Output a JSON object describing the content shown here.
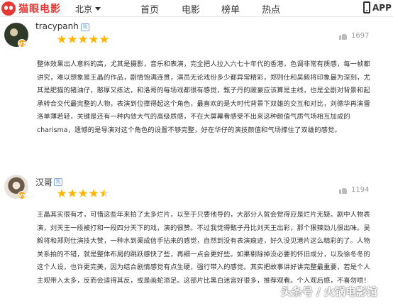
{
  "header": {
    "logo_text": "猫眼电影",
    "city": "北京",
    "nav": [
      "首页",
      "电影",
      "榜单",
      "热点"
    ],
    "app_label": "APP"
  },
  "reviews": [
    {
      "username": "tracypanh",
      "vip_label": "V2",
      "level_badge": "购",
      "rating": 5,
      "likes": "1697",
      "text": "整体效果出人意料的高，尤其是摄影，音乐和表演，完全把人拉入六七十年代的香港，色调非常有质感，每一帧都讲究，难以想象是王晶的作品，剧情饱满连贯，演员无论戏份多少都异常精彩，郑则仕和吴毅将印象最为深刻，尤其是肥猫的猪油仔，憨厚又练达，和洛哥的每场戏都很有感觉，甄子丹的跛豪应该算是主线，也是全剧对背景和起承转合交代最完整的人物，表演到位撑得起这个角色，最喜欢的是大时代背景下双雄的交互和对比，刘德华再演雷洛单薄若轻，关键是还有一种内敛大气的高级质感，不在大屏幕看感受不出来这种颜值气质气场相互加成的charisma，遗憾的是导演对这个角色的设置不够完整，好在华仔的演技颜值和气场撑住了双雄的感觉。"
    },
    {
      "username": "汉哥",
      "vip_label": "V5",
      "level_badge": "购",
      "rating": 4.5,
      "likes": "1194",
      "text": "王晶其实很有才，可惜这些年来拍了太多烂片，以至于只要他导的，大部分人就会觉得应是烂片无疑。剧中人物表演，刘天王一段被打和一段四分天下的戏，演的很赞。不过我觉得甄子丹比刘天王出彩，那个狠辣劲儿很出味。吴毅将和郑则仕演技大赞，一种水到渠成信手拈来的感觉，自然到没有表演痕迹，好久没见港片这么精彩的了。人物关系拍的不错，就是整体布局的跳跃感快了些，再细一点会更好些。如果剔除掉没必要的怀旧成分，以及徐冬冬的这个人设，也许更完美，因为结合剧情感觉有点生硬，强行带入的感觉。其实把故事讲好讲完整最重要，若是个人主观带入太多，反而会适得其反，或是画蛇添足。这部片比黑白迷宫好很多，推荐观看。个人观后感，不喜勿喷！"
    }
  ],
  "watermark": "头条号 / 火锅电影馆",
  "colors": {
    "brand": "#e53935",
    "star": "#ffb400",
    "vip": "#f5a623"
  }
}
